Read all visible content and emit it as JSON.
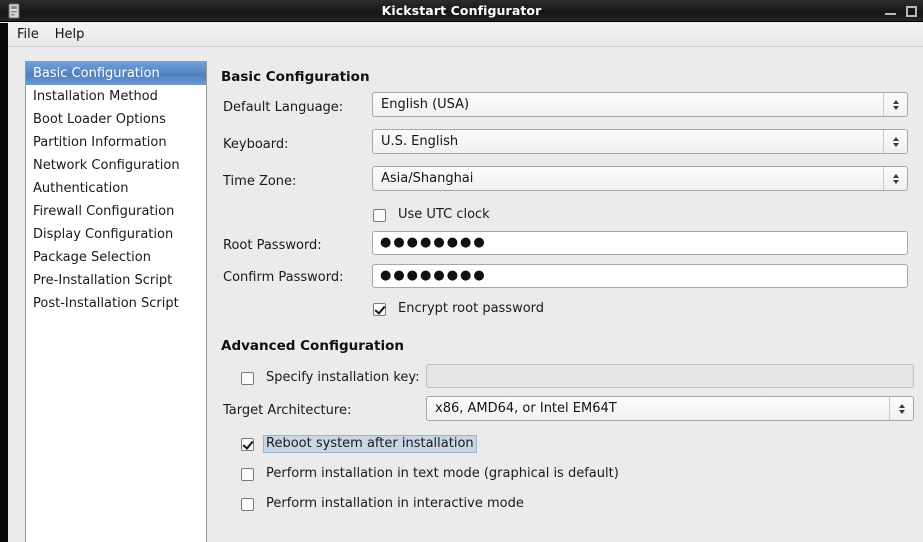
{
  "window": {
    "title": "Kickstart Configurator",
    "app_icon": "app-icon",
    "minimize_label": "Minimize",
    "maximize_label": "Maximize"
  },
  "menubar": {
    "items": [
      {
        "label": "File"
      },
      {
        "label": "Help"
      }
    ]
  },
  "sidebar": {
    "items": [
      {
        "label": "Basic Configuration",
        "selected": true
      },
      {
        "label": "Installation Method",
        "selected": false
      },
      {
        "label": "Boot Loader Options",
        "selected": false
      },
      {
        "label": "Partition Information",
        "selected": false
      },
      {
        "label": "Network Configuration",
        "selected": false
      },
      {
        "label": "Authentication",
        "selected": false
      },
      {
        "label": "Firewall Configuration",
        "selected": false
      },
      {
        "label": "Display Configuration",
        "selected": false
      },
      {
        "label": "Package Selection",
        "selected": false
      },
      {
        "label": "Pre-Installation Script",
        "selected": false
      },
      {
        "label": "Post-Installation Script",
        "selected": false
      }
    ]
  },
  "basic": {
    "heading": "Basic Configuration",
    "default_language": {
      "label": "Default Language:",
      "value": "English (USA)"
    },
    "keyboard": {
      "label": "Keyboard:",
      "value": "U.S. English"
    },
    "timezone": {
      "label": "Time Zone:",
      "value": "Asia/Shanghai"
    },
    "use_utc_clock": {
      "label": "Use UTC clock",
      "checked": false
    },
    "root_password": {
      "label": "Root Password:",
      "value": "●●●●●●●●"
    },
    "confirm_password": {
      "label": "Confirm Password:",
      "value": "●●●●●●●●"
    },
    "encrypt_root_password": {
      "label": "Encrypt root password",
      "checked": true
    }
  },
  "advanced": {
    "heading": "Advanced Configuration",
    "installation_key": {
      "label": "Specify installation key:",
      "checked": false,
      "value": "",
      "placeholder": "",
      "disabled": true
    },
    "target_architecture": {
      "label": "Target Architecture:",
      "value": "x86, AMD64, or Intel EM64T"
    },
    "reboot_after_install": {
      "label": "Reboot system after installation",
      "checked": true,
      "focused": true
    },
    "text_mode": {
      "label": "Perform installation in text mode (graphical is default)",
      "checked": false
    },
    "interactive_mode": {
      "label": "Perform installation in interactive mode",
      "checked": false
    }
  },
  "colors": {
    "selection_blue": "#5585c4",
    "panel_bg": "#ebebeb",
    "list_bg": "#ffffff",
    "titlebar_bg": "#1c1c1c",
    "focus_highlight": "#c9d6e6"
  }
}
